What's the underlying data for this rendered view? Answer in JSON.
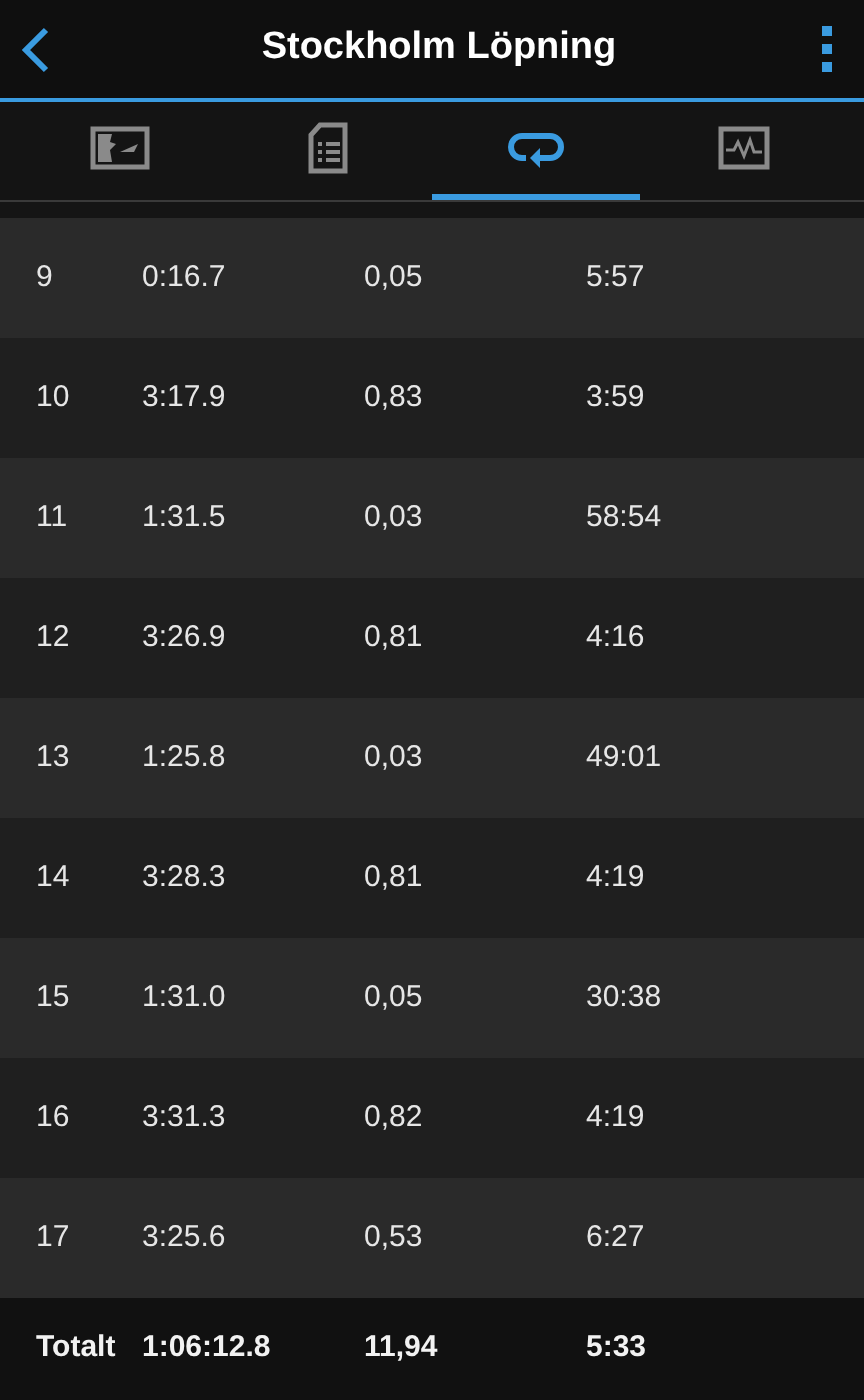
{
  "header": {
    "title": "Stockholm Löpning"
  },
  "tabs": [
    {
      "kind": "map",
      "selected": false
    },
    {
      "kind": "details",
      "selected": false
    },
    {
      "kind": "laps",
      "selected": true
    },
    {
      "kind": "chart",
      "selected": false
    }
  ],
  "laps": [
    {
      "lap": "9",
      "time": "0:16.7",
      "distance": "0,05",
      "pace": "5:57"
    },
    {
      "lap": "10",
      "time": "3:17.9",
      "distance": "0,83",
      "pace": "3:59"
    },
    {
      "lap": "11",
      "time": "1:31.5",
      "distance": "0,03",
      "pace": "58:54"
    },
    {
      "lap": "12",
      "time": "3:26.9",
      "distance": "0,81",
      "pace": "4:16"
    },
    {
      "lap": "13",
      "time": "1:25.8",
      "distance": "0,03",
      "pace": "49:01"
    },
    {
      "lap": "14",
      "time": "3:28.3",
      "distance": "0,81",
      "pace": "4:19"
    },
    {
      "lap": "15",
      "time": "1:31.0",
      "distance": "0,05",
      "pace": "30:38"
    },
    {
      "lap": "16",
      "time": "3:31.3",
      "distance": "0,82",
      "pace": "4:19"
    },
    {
      "lap": "17",
      "time": "3:25.6",
      "distance": "0,53",
      "pace": "6:27"
    }
  ],
  "total": {
    "label": "Totalt",
    "time": "1:06:12.8",
    "distance": "11,94",
    "pace": "5:33"
  }
}
